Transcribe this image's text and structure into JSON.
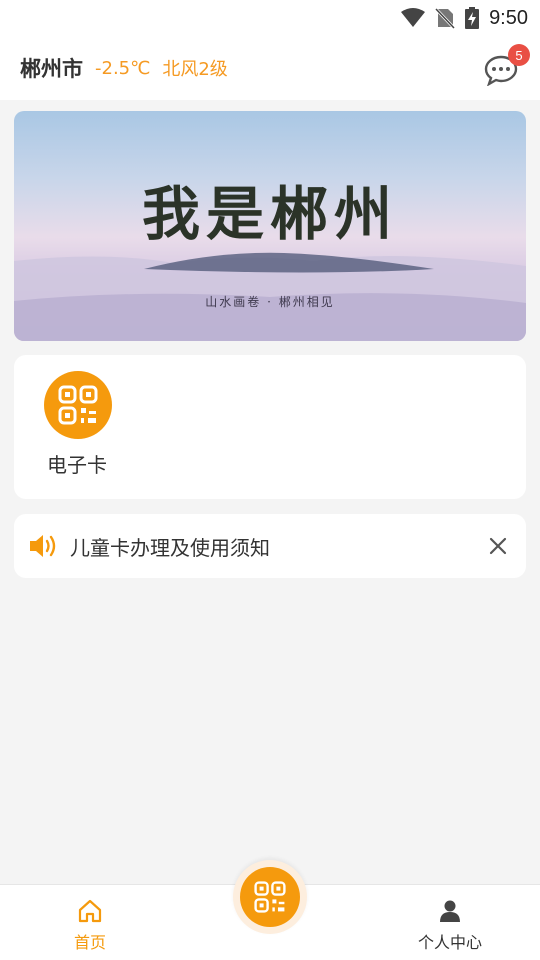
{
  "status_bar": {
    "time": "9:50"
  },
  "header": {
    "city": "郴州市",
    "temperature": "-2.5℃",
    "wind": "北风2级",
    "message_badge": "5"
  },
  "banner": {
    "title": "我是郴州",
    "subtitle": "山水画卷 · 郴州相见"
  },
  "functions": [
    {
      "label": "电子卡",
      "icon": "qr-code-icon"
    }
  ],
  "notice": {
    "text": "儿童卡办理及使用须知",
    "icon": "speaker-icon"
  },
  "tabbar": {
    "items": [
      {
        "label": "首页",
        "icon": "home-icon"
      },
      {
        "label": "个人中心",
        "icon": "user-icon"
      }
    ],
    "center_icon": "qr-code-icon"
  },
  "colors": {
    "accent": "#f59a0d",
    "badge": "#e94f44"
  }
}
